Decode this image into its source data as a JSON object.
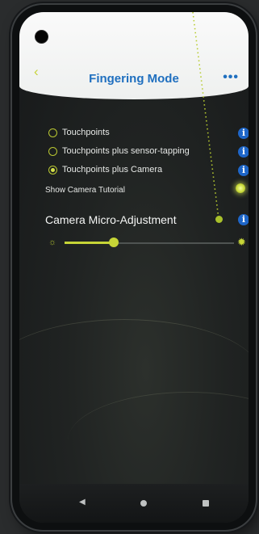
{
  "header": {
    "title": "Fingering Mode",
    "back_icon": "‹",
    "more_icon": "•••"
  },
  "options": [
    {
      "label": "Touchpoints",
      "selected": false
    },
    {
      "label": "Touchpoints plus sensor-tapping",
      "selected": false
    },
    {
      "label": "Touchpoints plus Camera",
      "selected": true
    }
  ],
  "tutorial": {
    "label": "Show Camera Tutorial",
    "enabled": true
  },
  "micro_adjustment": {
    "title": "Camera Micro-Adjustment",
    "slider_value_fraction": 0.29
  },
  "info_icon": "i",
  "colors": {
    "accent": "#c6d537",
    "title_blue": "#1f6fbf",
    "info_blue": "#1e66c8"
  },
  "icons": {
    "back": "chevron-left-icon",
    "more": "more-dots-icon",
    "info": "info-icon",
    "sun_dim": "brightness-low-icon",
    "sun_bright": "brightness-high-icon",
    "nav_back": "nav-back-icon",
    "nav_home": "nav-home-icon",
    "nav_recent": "nav-recent-icon"
  }
}
